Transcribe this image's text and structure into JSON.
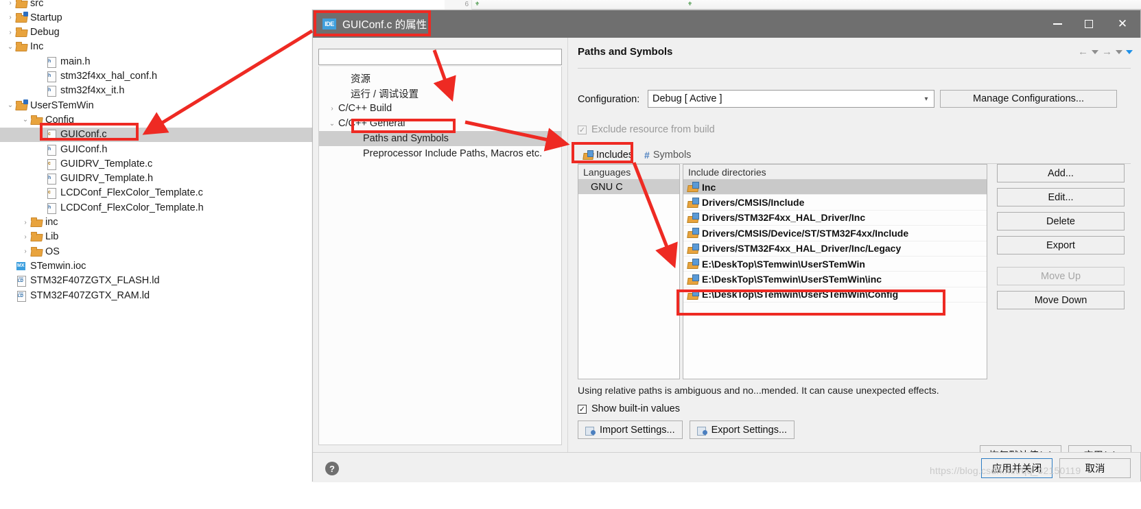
{
  "background": {
    "editor_line_number": "6",
    "project_tree": [
      {
        "label": "src",
        "indent": 0,
        "twisty": "›",
        "icon": "folder-icon",
        "selected": false,
        "partial": true
      },
      {
        "label": "Startup",
        "indent": 0,
        "twisty": "›",
        "icon": "folder-badge-icon",
        "selected": false
      },
      {
        "label": "Debug",
        "indent": 0,
        "twisty": "›",
        "icon": "folder-icon",
        "selected": false
      },
      {
        "label": "Inc",
        "indent": 0,
        "twisty": "⌄",
        "icon": "folder-open-icon",
        "selected": false
      },
      {
        "label": "main.h",
        "indent": 2,
        "twisty": "",
        "icon": "h-file-icon",
        "selected": false
      },
      {
        "label": "stm32f4xx_hal_conf.h",
        "indent": 2,
        "twisty": "",
        "icon": "h-file-icon",
        "selected": false
      },
      {
        "label": "stm32f4xx_it.h",
        "indent": 2,
        "twisty": "",
        "icon": "h-file-icon",
        "selected": false
      },
      {
        "label": "UserSTemWin",
        "indent": 0,
        "twisty": "⌄",
        "icon": "folder-badge-icon",
        "selected": false
      },
      {
        "label": "Config",
        "indent": 1,
        "twisty": "⌄",
        "icon": "folder-open-icon",
        "selected": false
      },
      {
        "label": "GUIConf.c",
        "indent": 2,
        "twisty": "",
        "icon": "c-file-icon",
        "selected": true
      },
      {
        "label": "GUIConf.h",
        "indent": 2,
        "twisty": "",
        "icon": "h-file-icon",
        "selected": false
      },
      {
        "label": "GUIDRV_Template.c",
        "indent": 2,
        "twisty": "",
        "icon": "c-file-icon",
        "selected": false
      },
      {
        "label": "GUIDRV_Template.h",
        "indent": 2,
        "twisty": "",
        "icon": "h-file-icon",
        "selected": false
      },
      {
        "label": "LCDConf_FlexColor_Template.c",
        "indent": 2,
        "twisty": "",
        "icon": "c-file-icon",
        "selected": false
      },
      {
        "label": "LCDConf_FlexColor_Template.h",
        "indent": 2,
        "twisty": "",
        "icon": "h-file-icon",
        "selected": false
      },
      {
        "label": "inc",
        "indent": 1,
        "twisty": "›",
        "icon": "folder-icon",
        "selected": false
      },
      {
        "label": "Lib",
        "indent": 1,
        "twisty": "›",
        "icon": "folder-icon",
        "selected": false
      },
      {
        "label": "OS",
        "indent": 1,
        "twisty": "›",
        "icon": "folder-icon",
        "selected": false
      },
      {
        "label": "STemwin.ioc",
        "indent": 0,
        "twisty": "",
        "icon": "ioc-file-icon",
        "selected": false
      },
      {
        "label": "STM32F407ZGTX_FLASH.ld",
        "indent": 0,
        "twisty": "",
        "icon": "ld-file-icon",
        "selected": false
      },
      {
        "label": "STM32F407ZGTX_RAM.ld",
        "indent": 0,
        "twisty": "",
        "icon": "ld-file-icon",
        "selected": false
      }
    ]
  },
  "dialog": {
    "title": "GUIConf.c 的属性",
    "app_badge": "IDE",
    "window_controls": {
      "minimize": "—",
      "maximize": "□",
      "close": "✕"
    },
    "filter_value": "",
    "filter_placeholder": "",
    "nav_tree": [
      {
        "label": "资源",
        "indent": 1,
        "twisty": "",
        "selected": false
      },
      {
        "label": "运行 / 调试设置",
        "indent": 1,
        "twisty": "",
        "selected": false
      },
      {
        "label": "C/C++ Build",
        "indent": 0,
        "twisty": "›",
        "selected": false
      },
      {
        "label": "C/C++ General",
        "indent": 0,
        "twisty": "⌄",
        "selected": false
      },
      {
        "label": "Paths and Symbols",
        "indent": 2,
        "twisty": "",
        "selected": true
      },
      {
        "label": "Preprocessor Include Paths, Macros etc.",
        "indent": 2,
        "twisty": "",
        "selected": false
      }
    ],
    "pane": {
      "title": "Paths and Symbols",
      "nav_back": "←",
      "nav_forward": "→",
      "configuration_label": "Configuration:",
      "configuration_value": "Debug  [ Active ]",
      "manage_configurations_label": "Manage Configurations...",
      "exclude_label": "Exclude resource from build",
      "exclude_checked": true,
      "tabs": [
        {
          "label": "Includes",
          "icon": "includes-icon",
          "active": true
        },
        {
          "label": "Symbols",
          "icon": "hash-icon",
          "active": false
        }
      ],
      "languages_header": "Languages",
      "languages": [
        "GNU C"
      ],
      "include_header": "Include directories",
      "include_directories": [
        "Inc",
        "Drivers/CMSIS/Include",
        "Drivers/STM32F4xx_HAL_Driver/Inc",
        "Drivers/CMSIS/Device/ST/STM32F4xx/Include",
        "Drivers/STM32F4xx_HAL_Driver/Inc/Legacy",
        "E:\\DeskTop\\STemwin\\UserSTemWin",
        "E:\\DeskTop\\STemwin\\UserSTemWin\\inc",
        "E:\\DeskTop\\STemwin\\UserSTemWin\\Config"
      ],
      "selected_include_index": 0,
      "highlighted_include_index": 7,
      "side_buttons": [
        {
          "label": "Add...",
          "enabled": true
        },
        {
          "label": "Edit...",
          "enabled": true
        },
        {
          "label": "Delete",
          "enabled": true
        },
        {
          "label": "Export",
          "enabled": true
        },
        {
          "label": "Move Up",
          "enabled": false
        },
        {
          "label": "Move Down",
          "enabled": true
        }
      ],
      "hint_text": "Using relative paths is ambiguous and no...mended. It can cause unexpected effects.",
      "show_builtin_label": "Show built-in values",
      "show_builtin_checked": true,
      "import_settings_label": "Import Settings...",
      "export_settings_label": "Export Settings...",
      "restore_defaults_label": "恢复默认值(D)",
      "apply_label": "应用(A)"
    },
    "help_icon": "?",
    "apply_and_close_label": "应用并关闭",
    "cancel_label": "取消"
  },
  "watermark": "https://blog.csdn.net/qq_42150119",
  "annotations": {
    "accent_color": "#ee2a23",
    "boxes": [
      {
        "name": "guiconf-c-tree-item"
      },
      {
        "name": "dialog-title"
      },
      {
        "name": "paths-and-symbols-nav"
      },
      {
        "name": "includes-tab"
      },
      {
        "name": "config-include-path"
      }
    ],
    "arrows": [
      {
        "name": "arrow-to-guiconf"
      },
      {
        "name": "arrow-to-nav-tree"
      },
      {
        "name": "arrow-to-includes-tab"
      },
      {
        "name": "arrow-to-include-list"
      }
    ]
  }
}
